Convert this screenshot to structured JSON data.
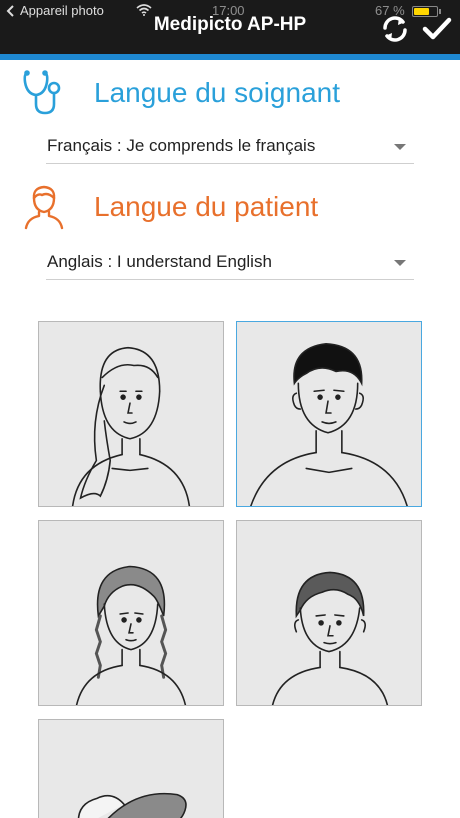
{
  "status_bar": {
    "back_app_label": "Appareil photo",
    "time": "17:00",
    "battery_text": "67 %",
    "battery_level": 0.67
  },
  "nav": {
    "title": "Medipicto AP-HP",
    "sync_icon": "sync-icon",
    "done_icon": "checkmark-icon"
  },
  "caregiver": {
    "icon": "stethoscope-icon",
    "title": "Langue du soignant",
    "selected_language": "Français : Je comprends le français"
  },
  "patient": {
    "icon": "person-icon",
    "title": "Langue du patient",
    "selected_language": "Anglais : I understand English"
  },
  "avatars": [
    {
      "name": "woman-avatar",
      "selected": false
    },
    {
      "name": "man-avatar",
      "selected": true
    },
    {
      "name": "girl-avatar",
      "selected": false
    },
    {
      "name": "boy-avatar",
      "selected": false
    },
    {
      "name": "baby-avatar",
      "selected": false
    }
  ],
  "colors": {
    "header_bg": "#1a1a1a",
    "accent_blue": "#1e88d2",
    "caregiver_color": "#2aa0da",
    "patient_color": "#e8702c",
    "tile_bg": "#e8e8e8"
  }
}
